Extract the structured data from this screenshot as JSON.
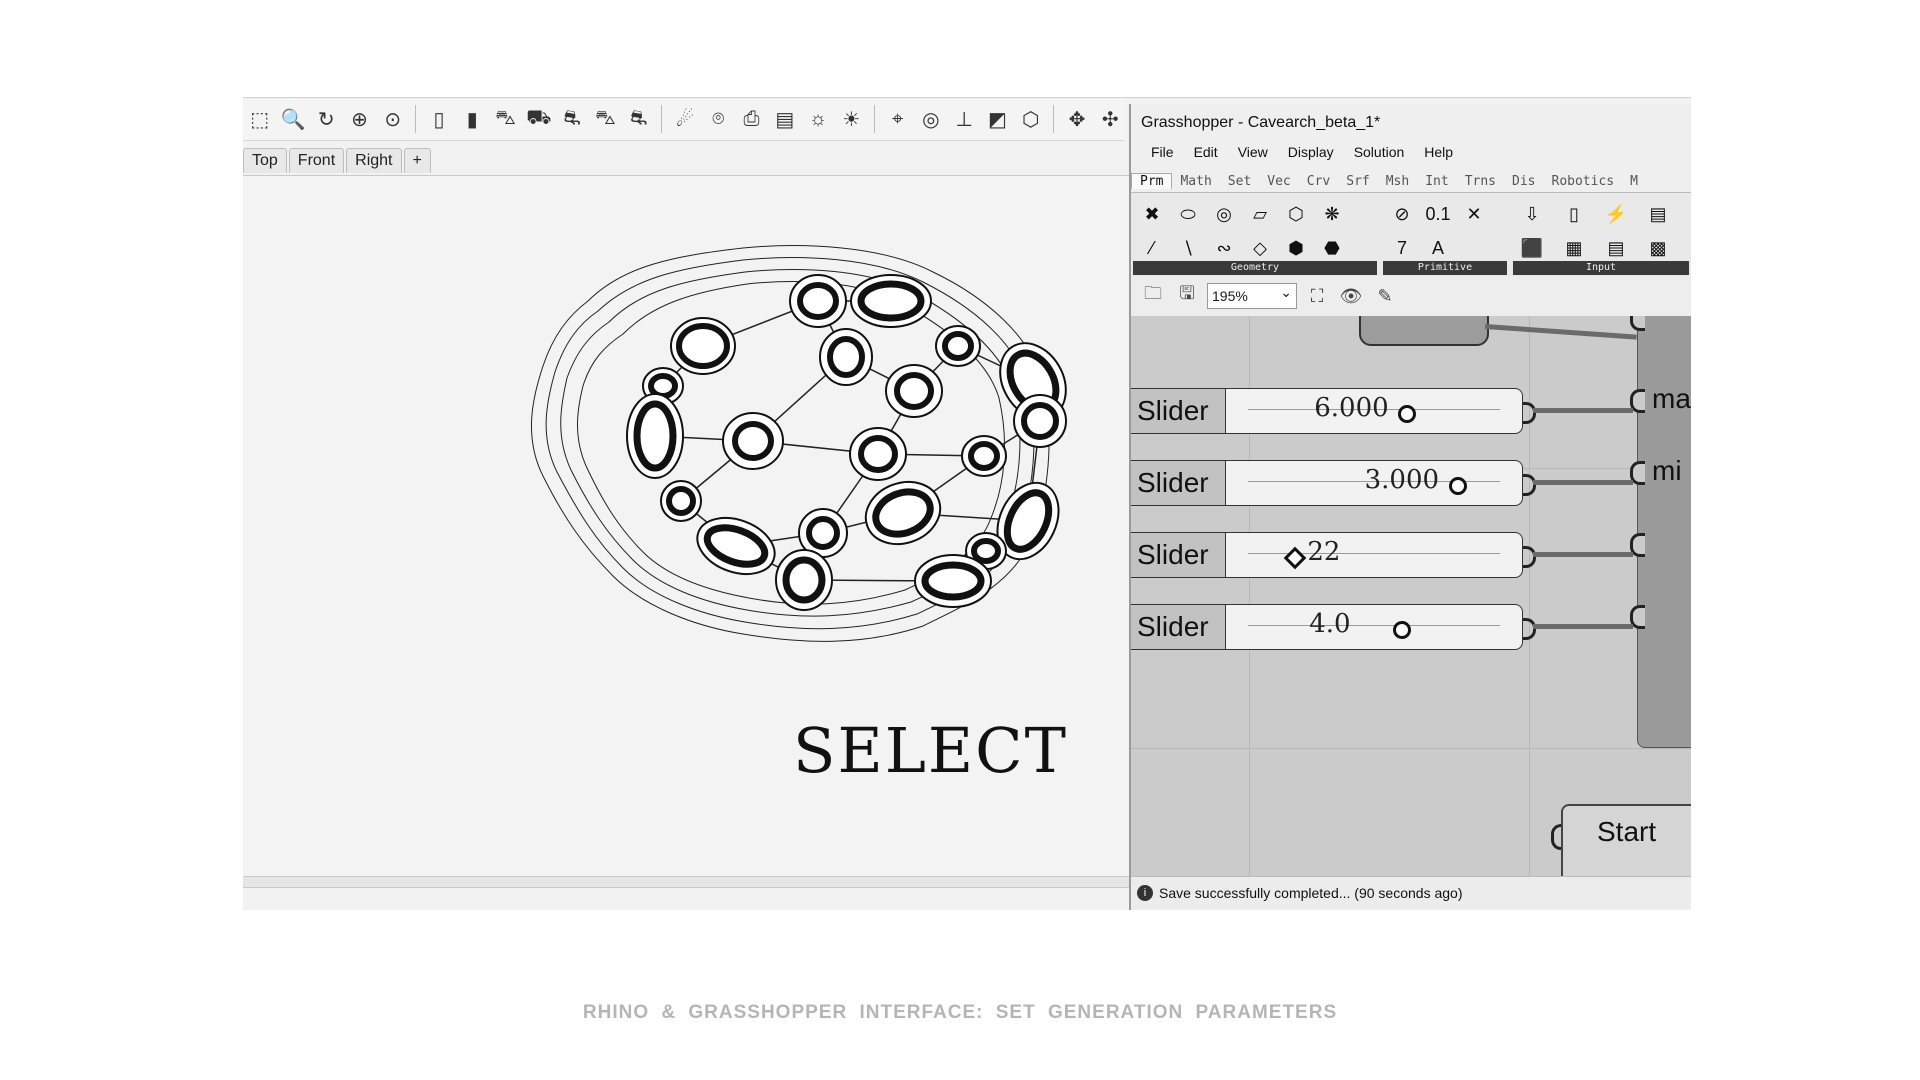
{
  "rhino": {
    "toolbar_icons": [
      "select-window-icon",
      "zoom-icon",
      "rotate-view-icon",
      "zoom-extents-icon",
      "zoom-1to1-icon",
      "phone-icon",
      "phone-alt-icon",
      "car-front-icon",
      "car-side-icon",
      "car-sedan-icon",
      "car-back-icon",
      "car-render-icon",
      "render-icon",
      "camera-icon",
      "print-icon",
      "layout-icon",
      "light-icon",
      "light-2-icon",
      "target-icon",
      "snap-icon",
      "gumball-icon",
      "material-icon",
      "box-3d-icon",
      "transform-icon",
      "transform-2-icon"
    ],
    "view_tabs": [
      "Top",
      "Front",
      "Right"
    ],
    "add_tab_label": "+",
    "overlay_text": "SELECT"
  },
  "grasshopper": {
    "title": "Grasshopper - Cavearch_beta_1*",
    "menu": [
      "File",
      "Edit",
      "View",
      "Display",
      "Solution",
      "Help"
    ],
    "tabs": [
      "Prm",
      "Math",
      "Set",
      "Vec",
      "Crv",
      "Srf",
      "Msh",
      "Int",
      "Trns",
      "Dis",
      "Robotics",
      "M"
    ],
    "active_tab": "Prm",
    "ribbon_groups": [
      {
        "name": "Geometry",
        "icons": [
          "✖",
          "⬭",
          "◎",
          "▱",
          "⬡",
          "❋",
          "⁄",
          "∖",
          "∾",
          "◇",
          "⬢",
          "⬣"
        ]
      },
      {
        "name": "Primitive",
        "icons": [
          "⊘",
          "0.1",
          "✕",
          "7",
          "A"
        ]
      },
      {
        "name": "Input",
        "icons": [
          "⇩",
          "▯",
          "⚡",
          "▤",
          "⬛",
          "▦",
          "▤",
          "▩"
        ]
      }
    ],
    "zoom": "195%",
    "sliders": [
      {
        "label": "Slider",
        "value": "6.000",
        "fraction": 0.62
      },
      {
        "label": "Slider",
        "value": "3.000",
        "fraction": 0.82
      },
      {
        "label": "Slider",
        "value": "22",
        "fraction": 0.18
      },
      {
        "label": "Slider",
        "value": "4.0",
        "fraction": 0.6
      }
    ],
    "component_inputs": [
      "ma",
      "mi",
      "",
      ""
    ],
    "start_label": "Start",
    "status": "Save successfully completed... (90 seconds ago)"
  },
  "caption": "RHINO &  GRASSHOPPER  INTERFACE:  SET  GENERATION  PARAMETERS"
}
